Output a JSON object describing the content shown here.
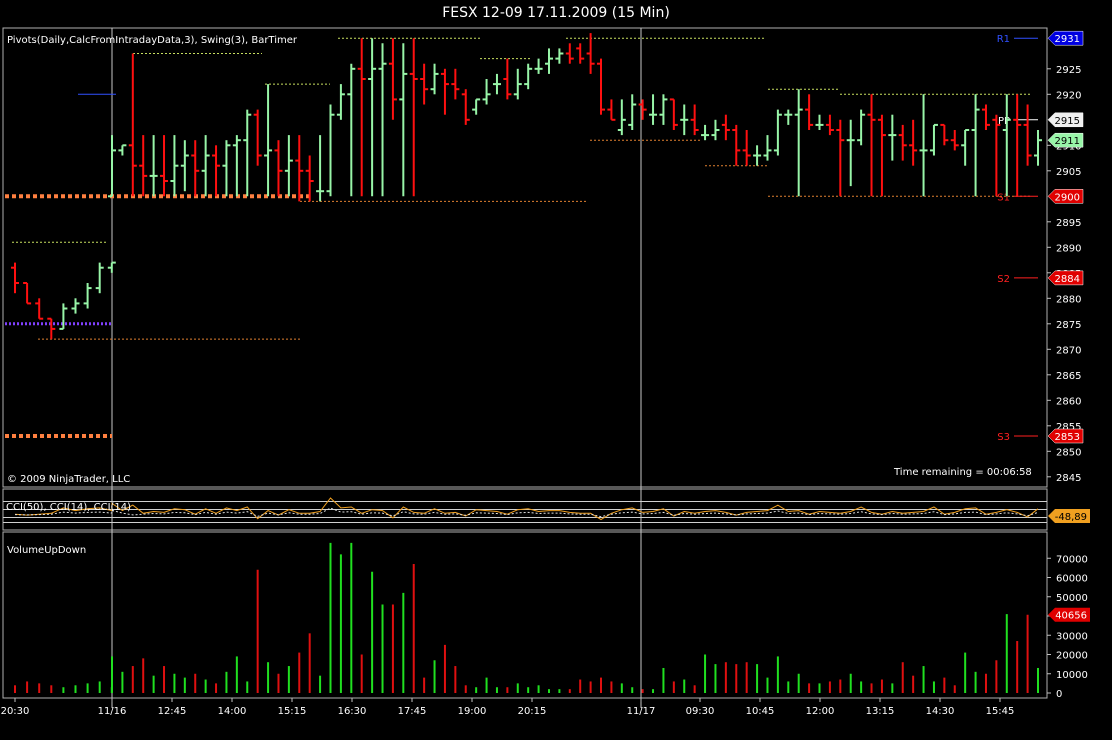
{
  "window_title": "FESX 12-09  17.11.2009 (15 Min)",
  "main_panel": {
    "indicator_caption": "Pivots(Daily,CalcFromIntradayData,3),  Swing(3), BarTimer",
    "copyright": "© 2009 NinjaTrader, LLC",
    "timer_text": "Time remaining = 00:06:58",
    "y_ticks": [
      2925,
      2920,
      2910,
      2905,
      2895,
      2890,
      2885,
      2880,
      2875,
      2870,
      2865,
      2860,
      2855,
      2850,
      2845
    ],
    "ylim": [
      2843,
      2933
    ],
    "price_markers": [
      {
        "label": "2931",
        "value": 2931,
        "color": "#0000e0",
        "text_color": "#ffffff"
      },
      {
        "label": "2915",
        "value": 2915,
        "color": "#f0f0f0",
        "text_color": "#000000"
      },
      {
        "label": "2911",
        "value": 2911,
        "color": "#98f5a8",
        "text_color": "#000000"
      },
      {
        "label": "2900",
        "value": 2900,
        "color": "#e00000",
        "text_color": "#ffffff"
      },
      {
        "label": "2884",
        "value": 2884,
        "color": "#e00000",
        "text_color": "#ffffff"
      },
      {
        "label": "2853",
        "value": 2853,
        "color": "#e00000",
        "text_color": "#ffffff"
      }
    ],
    "pivot_levels": [
      {
        "name": "R1",
        "value": 2931,
        "color": "#3050ff"
      },
      {
        "name": "PP",
        "value": 2915,
        "color": "#ffffff"
      },
      {
        "name": "S1",
        "value": 2900,
        "color": "#ff2020"
      },
      {
        "name": "S2",
        "value": 2884,
        "color": "#ff2020"
      },
      {
        "name": "S3",
        "value": 2853,
        "color": "#ff2020"
      }
    ]
  },
  "cci_panel": {
    "caption": "CCI(50), CCI(14), CCI(14)",
    "value_label": "-48,89"
  },
  "volume_panel": {
    "caption": "VolumeUpDown",
    "y_ticks": [
      70000,
      60000,
      50000,
      40000,
      30000,
      20000,
      10000,
      0
    ],
    "ylim": [
      0,
      80000
    ],
    "last_label": "40656"
  },
  "x_axis": {
    "labels": [
      "20:30",
      "11/16",
      "12:45",
      "14:00",
      "15:15",
      "16:30",
      "17:45",
      "19:00",
      "20:15",
      "11/17",
      "09:30",
      "10:45",
      "12:00",
      "13:15",
      "14:30",
      "15:45"
    ]
  },
  "chart_data": {
    "type": "ohlc",
    "title": "FESX 12-09  17.11.2009 (15 Min)",
    "bars": [
      {
        "o": 2886,
        "h": 2887,
        "l": 2881,
        "c": 2883,
        "v": 4000
      },
      {
        "o": 2883,
        "h": 2883,
        "l": 2879,
        "c": 2879,
        "v": 6000
      },
      {
        "o": 2879,
        "h": 2880,
        "l": 2876,
        "c": 2876,
        "v": 5000
      },
      {
        "o": 2876,
        "h": 2876,
        "l": 2872,
        "c": 2874,
        "v": 4000
      },
      {
        "o": 2874,
        "h": 2879,
        "l": 2874,
        "c": 2878,
        "v": 3000
      },
      {
        "o": 2878,
        "h": 2880,
        "l": 2877,
        "c": 2879,
        "v": 4000
      },
      {
        "o": 2879,
        "h": 2883,
        "l": 2878,
        "c": 2882,
        "v": 5000
      },
      {
        "o": 2882,
        "h": 2887,
        "l": 2881,
        "c": 2886,
        "v": 6000
      },
      {
        "o": 2886,
        "h": 2887,
        "l": 2885,
        "c": 2887,
        "v": 3000
      },
      {
        "o": 2900,
        "h": 2912,
        "l": 2900,
        "c": 2909,
        "v": 19000
      },
      {
        "o": 2909,
        "h": 2910,
        "l": 2908,
        "c": 2910,
        "v": 11000
      },
      {
        "o": 2910,
        "h": 2928,
        "l": 2900,
        "c": 2906,
        "v": 14000
      },
      {
        "o": 2906,
        "h": 2912,
        "l": 2900,
        "c": 2904,
        "v": 18000
      },
      {
        "o": 2904,
        "h": 2912,
        "l": 2900,
        "c": 2904,
        "v": 9000
      },
      {
        "o": 2904,
        "h": 2912,
        "l": 2900,
        "c": 2903,
        "v": 14000
      },
      {
        "o": 2903,
        "h": 2912,
        "l": 2900,
        "c": 2906,
        "v": 10000
      },
      {
        "o": 2906,
        "h": 2911,
        "l": 2901,
        "c": 2908,
        "v": 8000
      },
      {
        "o": 2908,
        "h": 2911,
        "l": 2900,
        "c": 2905,
        "v": 10000
      },
      {
        "o": 2905,
        "h": 2912,
        "l": 2900,
        "c": 2908,
        "v": 7000
      },
      {
        "o": 2908,
        "h": 2910,
        "l": 2900,
        "c": 2906,
        "v": 5000
      },
      {
        "o": 2906,
        "h": 2911,
        "l": 2900,
        "c": 2910,
        "v": 11000
      },
      {
        "o": 2910,
        "h": 2912,
        "l": 2900,
        "c": 2911,
        "v": 19000
      },
      {
        "o": 2911,
        "h": 2917,
        "l": 2900,
        "c": 2916,
        "v": 6000
      },
      {
        "o": 2916,
        "h": 2917,
        "l": 2906,
        "c": 2908,
        "v": 64000
      },
      {
        "o": 2908,
        "h": 2922,
        "l": 2900,
        "c": 2909,
        "v": 16000
      },
      {
        "o": 2909,
        "h": 2911,
        "l": 2900,
        "c": 2905,
        "v": 10000
      },
      {
        "o": 2905,
        "h": 2912,
        "l": 2900,
        "c": 2907,
        "v": 14000
      },
      {
        "o": 2907,
        "h": 2912,
        "l": 2899,
        "c": 2905,
        "v": 21000
      },
      {
        "o": 2905,
        "h": 2908,
        "l": 2899,
        "c": 2903,
        "v": 31000
      },
      {
        "o": 2901,
        "h": 2912,
        "l": 2899,
        "c": 2901,
        "v": 9000
      },
      {
        "o": 2901,
        "h": 2918,
        "l": 2900,
        "c": 2916,
        "v": 78000
      },
      {
        "o": 2916,
        "h": 2922,
        "l": 2915,
        "c": 2920,
        "v": 72000
      },
      {
        "o": 2920,
        "h": 2926,
        "l": 2900,
        "c": 2925,
        "v": 78000
      },
      {
        "o": 2925,
        "h": 2931,
        "l": 2900,
        "c": 2923,
        "v": 20000
      },
      {
        "o": 2923,
        "h": 2931,
        "l": 2900,
        "c": 2925,
        "v": 63000
      },
      {
        "o": 2925,
        "h": 2930,
        "l": 2900,
        "c": 2926,
        "v": 46000
      },
      {
        "o": 2926,
        "h": 2931,
        "l": 2915,
        "c": 2919,
        "v": 46000
      },
      {
        "o": 2919,
        "h": 2930,
        "l": 2900,
        "c": 2924,
        "v": 52000
      },
      {
        "o": 2924,
        "h": 2931,
        "l": 2900,
        "c": 2923,
        "v": 67000
      },
      {
        "o": 2923,
        "h": 2926,
        "l": 2918,
        "c": 2921,
        "v": 8000
      },
      {
        "o": 2921,
        "h": 2926,
        "l": 2920,
        "c": 2924,
        "v": 17000
      },
      {
        "o": 2924,
        "h": 2925,
        "l": 2916,
        "c": 2922,
        "v": 25000
      },
      {
        "o": 2922,
        "h": 2925,
        "l": 2919,
        "c": 2921,
        "v": 14000
      },
      {
        "o": 2920,
        "h": 2921,
        "l": 2914,
        "c": 2915,
        "v": 4000
      },
      {
        "o": 2917,
        "h": 2919,
        "l": 2916,
        "c": 2919,
        "v": 3000
      },
      {
        "o": 2919,
        "h": 2923,
        "l": 2918,
        "c": 2920,
        "v": 8000
      },
      {
        "o": 2922,
        "h": 2924,
        "l": 2920,
        "c": 2922,
        "v": 3000
      },
      {
        "o": 2923,
        "h": 2927,
        "l": 2919,
        "c": 2920,
        "v": 3000
      },
      {
        "o": 2920,
        "h": 2925,
        "l": 2919,
        "c": 2922,
        "v": 5000
      },
      {
        "o": 2922,
        "h": 2926,
        "l": 2921,
        "c": 2925,
        "v": 3000
      },
      {
        "o": 2925,
        "h": 2927,
        "l": 2924,
        "c": 2925,
        "v": 4000
      },
      {
        "o": 2926,
        "h": 2929,
        "l": 2924,
        "c": 2927,
        "v": 2000
      },
      {
        "o": 2927,
        "h": 2929,
        "l": 2926,
        "c": 2928,
        "v": 2000
      },
      {
        "o": 2928,
        "h": 2930,
        "l": 2926,
        "c": 2927,
        "v": 2000
      },
      {
        "o": 2929,
        "h": 2930,
        "l": 2926,
        "c": 2927,
        "v": 7000
      },
      {
        "o": 2928,
        "h": 2932,
        "l": 2924,
        "c": 2926,
        "v": 6000
      },
      {
        "o": 2926,
        "h": 2927,
        "l": 2916,
        "c": 2917,
        "v": 8000
      },
      {
        "o": 2917,
        "h": 2919,
        "l": 2915,
        "c": 2915,
        "v": 6000
      },
      {
        "o": 2913,
        "h": 2919,
        "l": 2912,
        "c": 2915,
        "v": 5000
      },
      {
        "o": 2914,
        "h": 2920,
        "l": 2913,
        "c": 2918,
        "v": 3000
      },
      {
        "o": 2918,
        "h": 2919,
        "l": 2915,
        "c": 2917,
        "v": 2000
      },
      {
        "o": 2916,
        "h": 2920,
        "l": 2914,
        "c": 2916,
        "v": 2000
      },
      {
        "o": 2916,
        "h": 2920,
        "l": 2914,
        "c": 2919,
        "v": 13000
      },
      {
        "o": 2919,
        "h": 2919,
        "l": 2913,
        "c": 2914,
        "v": 6000
      },
      {
        "o": 2915,
        "h": 2918,
        "l": 2912,
        "c": 2915,
        "v": 7000
      },
      {
        "o": 2915,
        "h": 2918,
        "l": 2912,
        "c": 2913,
        "v": 4000
      },
      {
        "o": 2912,
        "h": 2914,
        "l": 2911,
        "c": 2912,
        "v": 20000
      },
      {
        "o": 2912,
        "h": 2915,
        "l": 2911,
        "c": 2913,
        "v": 15000
      },
      {
        "o": 2914,
        "h": 2916,
        "l": 2911,
        "c": 2913,
        "v": 16000
      },
      {
        "o": 2913,
        "h": 2914,
        "l": 2906,
        "c": 2909,
        "v": 15000
      },
      {
        "o": 2909,
        "h": 2913,
        "l": 2906,
        "c": 2908,
        "v": 16000
      },
      {
        "o": 2908,
        "h": 2910,
        "l": 2906,
        "c": 2908,
        "v": 15000
      },
      {
        "o": 2908,
        "h": 2912,
        "l": 2907,
        "c": 2909,
        "v": 8000
      },
      {
        "o": 2909,
        "h": 2917,
        "l": 2908,
        "c": 2916,
        "v": 19000
      },
      {
        "o": 2916,
        "h": 2917,
        "l": 2914,
        "c": 2916,
        "v": 6000
      },
      {
        "o": 2916,
        "h": 2921,
        "l": 2900,
        "c": 2917,
        "v": 10000
      },
      {
        "o": 2917,
        "h": 2920,
        "l": 2913,
        "c": 2914,
        "v": 5000
      },
      {
        "o": 2914,
        "h": 2916,
        "l": 2913,
        "c": 2914,
        "v": 5000
      },
      {
        "o": 2914,
        "h": 2916,
        "l": 2912,
        "c": 2913,
        "v": 6000
      },
      {
        "o": 2913,
        "h": 2915,
        "l": 2900,
        "c": 2911,
        "v": 7000
      },
      {
        "o": 2911,
        "h": 2915,
        "l": 2902,
        "c": 2911,
        "v": 10000
      },
      {
        "o": 2911,
        "h": 2917,
        "l": 2910,
        "c": 2916,
        "v": 6000
      },
      {
        "o": 2916,
        "h": 2920,
        "l": 2900,
        "c": 2915,
        "v": 5000
      },
      {
        "o": 2915,
        "h": 2916,
        "l": 2900,
        "c": 2912,
        "v": 7000
      },
      {
        "o": 2912,
        "h": 2916,
        "l": 2907,
        "c": 2912,
        "v": 5000
      },
      {
        "o": 2912,
        "h": 2914,
        "l": 2907,
        "c": 2910,
        "v": 16000
      },
      {
        "o": 2910,
        "h": 2915,
        "l": 2906,
        "c": 2909,
        "v": 9000
      },
      {
        "o": 2909,
        "h": 2920,
        "l": 2900,
        "c": 2909,
        "v": 14000
      },
      {
        "o": 2909,
        "h": 2914,
        "l": 2908,
        "c": 2914,
        "v": 6000
      },
      {
        "o": 2914,
        "h": 2914,
        "l": 2910,
        "c": 2911,
        "v": 8000
      },
      {
        "o": 2911,
        "h": 2913,
        "l": 2909,
        "c": 2910,
        "v": 4000
      },
      {
        "o": 2910,
        "h": 2913,
        "l": 2906,
        "c": 2913,
        "v": 21000
      },
      {
        "o": 2913,
        "h": 2920,
        "l": 2900,
        "c": 2917,
        "v": 11000
      },
      {
        "o": 2917,
        "h": 2918,
        "l": 2913,
        "c": 2914,
        "v": 10000
      },
      {
        "o": 2915,
        "h": 2916,
        "l": 2900,
        "c": 2914,
        "v": 17000
      },
      {
        "o": 2913,
        "h": 2920,
        "l": 2900,
        "c": 2915,
        "v": 41000
      },
      {
        "o": 2915,
        "h": 2920,
        "l": 2900,
        "c": 2914,
        "v": 27000
      },
      {
        "o": 2914,
        "h": 2918,
        "l": 2906,
        "c": 2908,
        "v": 40656
      },
      {
        "o": 2908,
        "h": 2913,
        "l": 2906,
        "c": 2911,
        "v": 13000
      }
    ]
  }
}
